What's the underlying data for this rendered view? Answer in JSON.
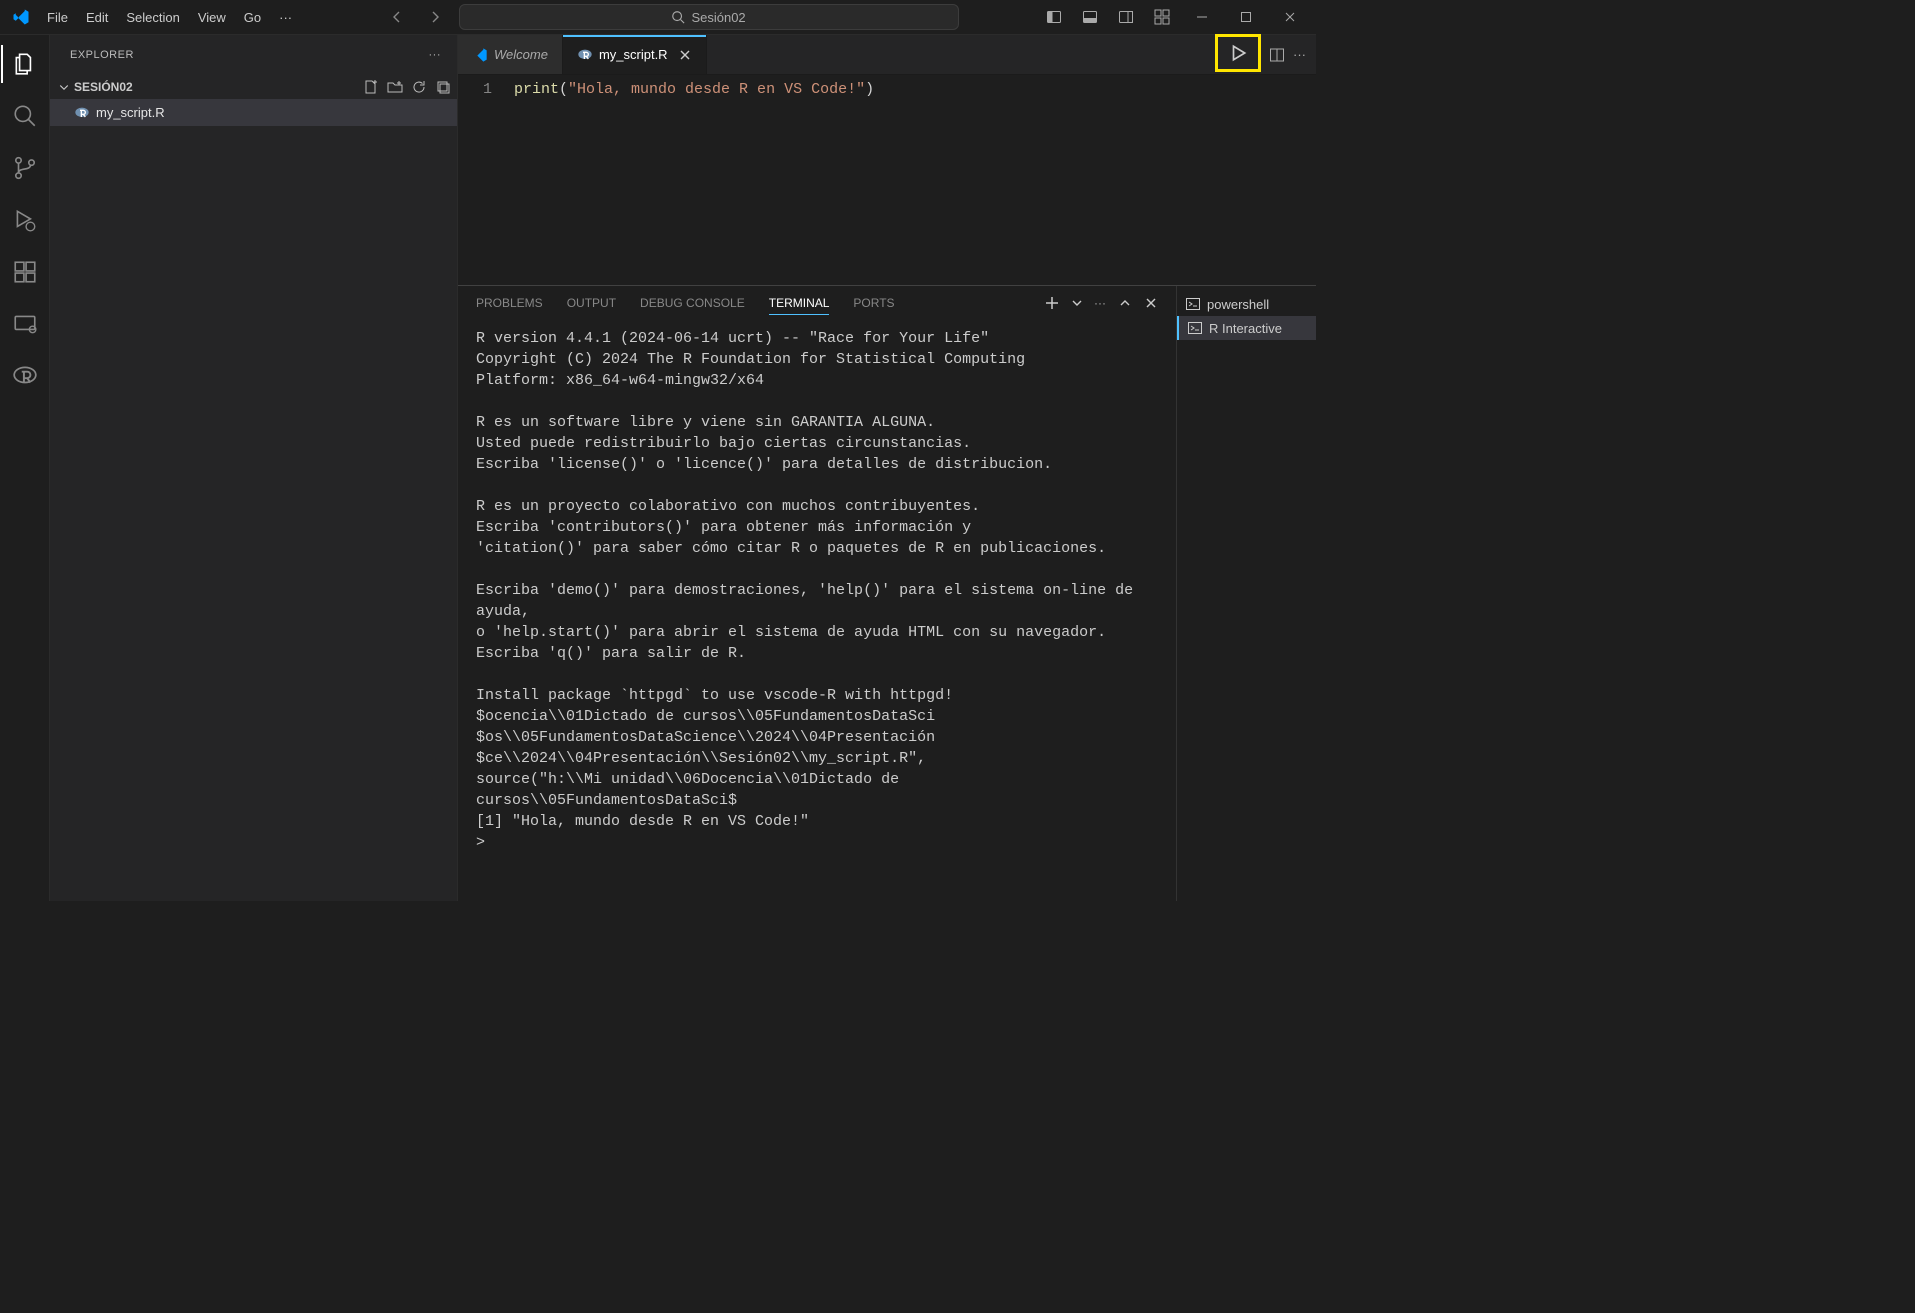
{
  "menu": {
    "file": "File",
    "edit": "Edit",
    "selection": "Selection",
    "view": "View",
    "go": "Go",
    "more": "···"
  },
  "search": {
    "placeholder": "Sesión02"
  },
  "explorer": {
    "title": "EXPLORER",
    "folder": "SESIÓN02",
    "file": "my_script.R"
  },
  "tabs": {
    "welcome": "Welcome",
    "script": "my_script.R"
  },
  "editor": {
    "lineNo": "1",
    "fn": "print",
    "open": "(",
    "str": "\"Hola, mundo desde R en VS Code!\"",
    "close": ")"
  },
  "panel": {
    "problems": "PROBLEMS",
    "output": "OUTPUT",
    "debug": "DEBUG CONSOLE",
    "terminal": "TERMINAL",
    "ports": "PORTS"
  },
  "terminal_text": "R version 4.4.1 (2024-06-14 ucrt) -- \"Race for Your Life\"\nCopyright (C) 2024 The R Foundation for Statistical Computing\nPlatform: x86_64-w64-mingw32/x64\n\nR es un software libre y viene sin GARANTIA ALGUNA.\nUsted puede redistribuirlo bajo ciertas circunstancias.\nEscriba 'license()' o 'licence()' para detalles de distribucion.\n\nR es un proyecto colaborativo con muchos contribuyentes.\nEscriba 'contributors()' para obtener más información y\n'citation()' para saber cómo citar R o paquetes de R en publicaciones.\n\nEscriba 'demo()' para demostraciones, 'help()' para el sistema on-line de ayuda,\no 'help.start()' para abrir el sistema de ayuda HTML con su navegador.\nEscriba 'q()' para salir de R.\n\nInstall package `httpgd` to use vscode-R with httpgd!\n$ocencia\\\\01Dictado de cursos\\\\05FundamentosDataSci\n$os\\\\05FundamentosDataScience\\\\2024\\\\04Presentación\n$ce\\\\2024\\\\04Presentación\\\\Sesión02\\\\my_script.R\",\nsource(\"h:\\\\Mi unidad\\\\06Docencia\\\\01Dictado de cursos\\\\05FundamentosDataSci$\n[1] \"Hola, mundo desde R en VS Code!\"\n> ",
  "term_list": {
    "powershell": "powershell",
    "rinteractive": "R Interactive"
  }
}
